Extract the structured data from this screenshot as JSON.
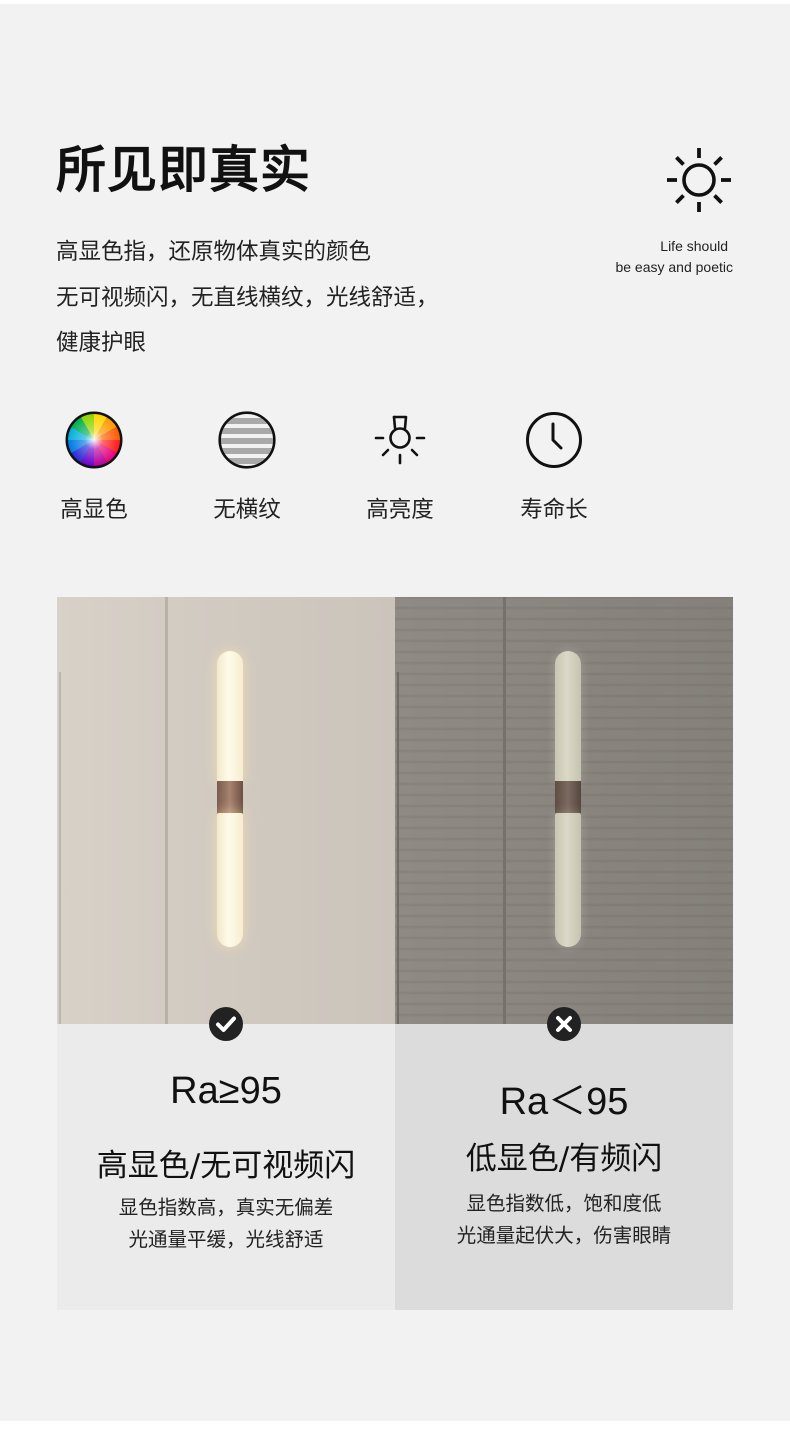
{
  "header": {
    "title": "所见即真实",
    "slogan_line1": "Life should",
    "slogan_line2": "be easy and poetic",
    "icon": "sun-icon"
  },
  "description": [
    "高显色指，还原物体真实的颜色",
    "无可视频闪，无直线横纹，光线舒适，",
    "健康护眼"
  ],
  "features": [
    {
      "label": "高显色",
      "icon": "color-wheel-icon"
    },
    {
      "label": "无横纹",
      "icon": "striped-circle-icon"
    },
    {
      "label": "高亮度",
      "icon": "light-bulb-icon"
    },
    {
      "label": "寿命长",
      "icon": "clock-icon"
    }
  ],
  "comparison": {
    "good": {
      "icon": "check-icon",
      "ra": "Ra≥95",
      "subtitle": "高显色/无可视频闪",
      "note1": "显色指数高，真实无偏差",
      "note2": "光通量平缓，光线舒适"
    },
    "bad": {
      "icon": "cross-icon",
      "ra": "Ra＜95",
      "subtitle": "低显色/有频闪",
      "note1": "显色指数低，饱和度低",
      "note2": "光通量起伏大，伤害眼睛"
    }
  },
  "colors": {
    "background": "#f2f2f2",
    "text": "#111111",
    "good_panel": "#ebebeb",
    "bad_panel": "#dcdcdc",
    "badge": "#222222"
  }
}
